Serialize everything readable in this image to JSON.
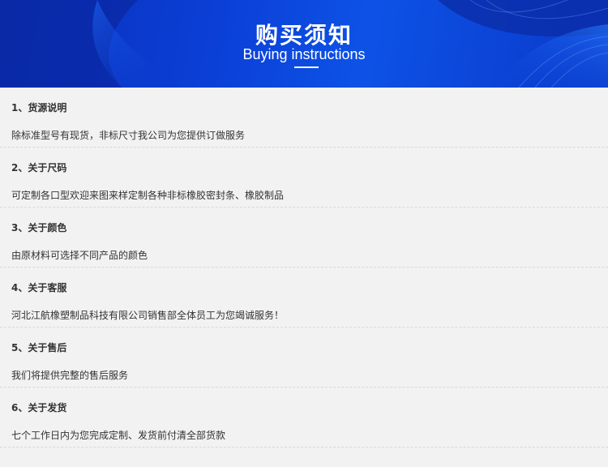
{
  "banner": {
    "title": "购买须知",
    "subtitle": "Buying instructions",
    "colors": {
      "primary": "#0b3fd6",
      "dark": "#0a2fb8",
      "text": "#ffffff"
    }
  },
  "items": [
    {
      "title": "1、货源说明",
      "text": "除标准型号有现货，非标尺寸我公司为您提供订做服务"
    },
    {
      "title": "2、关于尺码",
      "text": "可定制各口型欢迎来图来样定制各种非标橡胶密封条、橡胶制品"
    },
    {
      "title": "3、关于颜色",
      "text": "由原材料可选择不同产品的颜色"
    },
    {
      "title": "4、关于客服",
      "text": "河北江航橡塑制品科技有限公司销售部全体员工为您竭诚服务！"
    },
    {
      "title": "5、关于售后",
      "text": "我们将提供完整的售后服务"
    },
    {
      "title": "6、关于发货",
      "text": "七个工作日内为您完成定制、发货前付清全部货款"
    }
  ]
}
